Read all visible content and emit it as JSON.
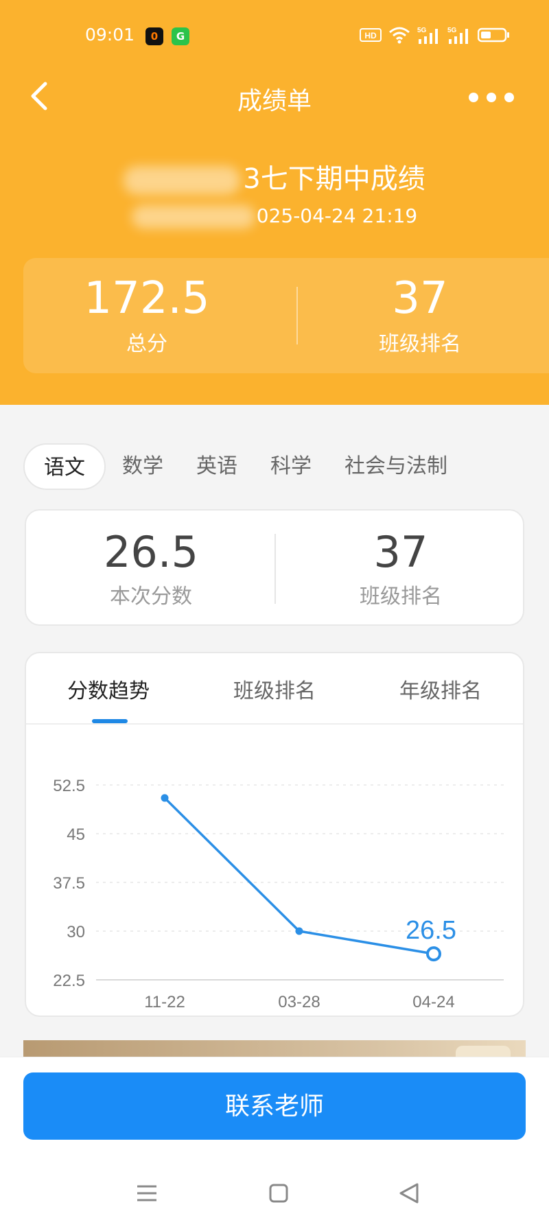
{
  "status_bar": {
    "time": "09:01",
    "badge1": "0",
    "badge2": "G",
    "icons": [
      "hd-icon",
      "wifi-icon",
      "signal-5g-icon",
      "signal-5g-icon",
      "battery-icon"
    ],
    "hd_label": "HD",
    "net1": "5G",
    "net2": "5G"
  },
  "header": {
    "title": "成绩单",
    "exam_title_visible": "3七下期中成绩",
    "exam_date_visible": "025-04-24 21:19",
    "total_score": "172.5",
    "total_label": "总分",
    "class_rank": "37",
    "class_rank_label": "班级排名",
    "bg_color": "#fbb22e"
  },
  "subjects": {
    "tabs": [
      "语文",
      "数学",
      "英语",
      "科学",
      "社会与法制"
    ],
    "active_index": 0
  },
  "subject_summary": {
    "score": "26.5",
    "score_label": "本次分数",
    "rank": "37",
    "rank_label": "班级排名"
  },
  "trend": {
    "tabs": [
      "分数趋势",
      "班级排名",
      "年级排名"
    ],
    "active_index": 0,
    "accent": "#2b8fe6"
  },
  "chart_data": {
    "type": "line",
    "categories": [
      "11-22",
      "03-28",
      "04-24"
    ],
    "values": [
      50.5,
      30,
      26.5
    ],
    "yticks": [
      "52.5",
      "45",
      "37.5",
      "30",
      "22.5"
    ],
    "ylim": [
      22.5,
      52.5
    ],
    "highlight_label": "26.5",
    "grid": true,
    "line_color": "#2b8fe6"
  },
  "bottom": {
    "contact_button": "联系老师",
    "button_color": "#1a8cf7"
  }
}
